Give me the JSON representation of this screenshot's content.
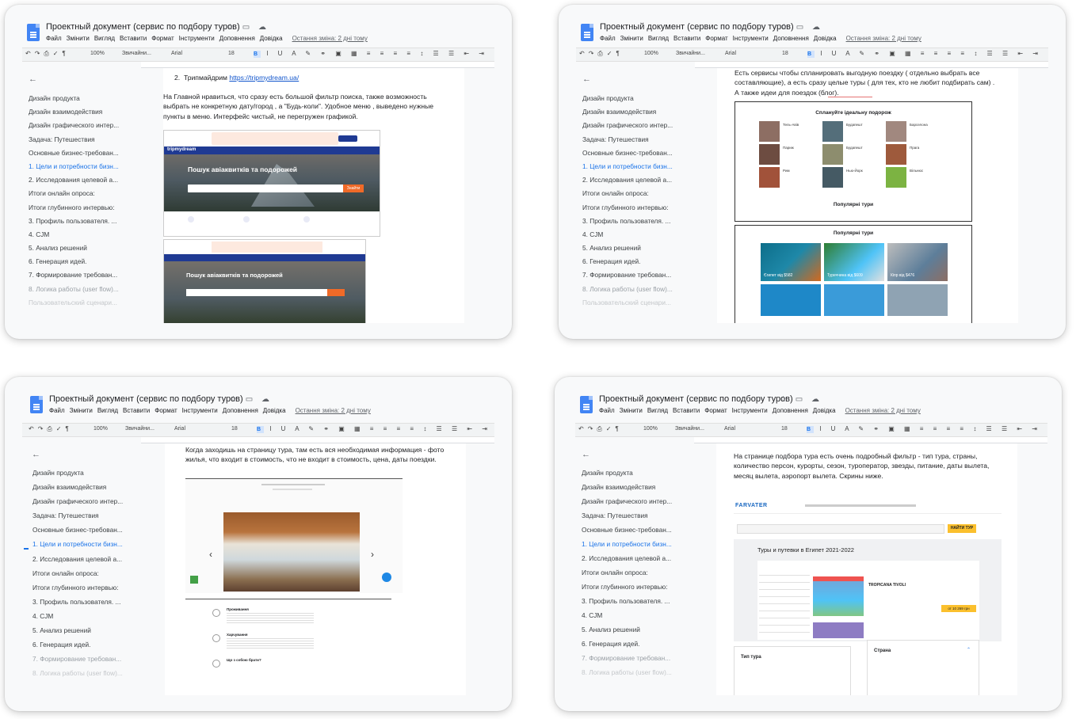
{
  "doc": {
    "title": "Проектный документ (сервис по подбору туров)",
    "menu": [
      "Файл",
      "Змінити",
      "Вигляд",
      "Вставити",
      "Формат",
      "Інструменти",
      "Доповнення",
      "Довідка"
    ],
    "last_edit": "Остання зміна: 2 дні тому",
    "toolbar": {
      "zoom": "100%",
      "style": "Звичайни...",
      "font": "Arial",
      "size": "18"
    },
    "outline": [
      "Дизайн продукта",
      "Дизайн взаимодействия",
      "Дизайн графического интер...",
      "Задача: Путешествия",
      "Основные бизнес-требован...",
      "1. Цели и потребности бизн...",
      "2. Исследования целевой а...",
      "Итоги онлайн опроса:",
      "Итоги глубинного интервью:",
      "3. Профиль пользователя. ...",
      "4. CJM",
      "5. Анализ решений",
      "6. Генерация идей.",
      "7. Формирование требован...",
      "8. Логика работы (user flow)...",
      "Пользовательский сценари..."
    ],
    "outline_bl": [
      "Дизайн продукта",
      "Дизайн взаимодействия",
      "Дизайн графического интер...",
      "Задача: Путешествия",
      "Основные бизнес-требован...",
      "1. Цели и потребности бизн...",
      "2. Исследования целевой а...",
      "Итоги онлайн опроса:",
      "Итоги глубинного интервью:",
      "3. Профиль пользователя. ...",
      "4. CJM",
      "5. Анализ решений",
      "6. Генерация идей.",
      "7. Формирование требован...",
      "8. Логика работы (user flow)..."
    ]
  },
  "panel1": {
    "heading_num": "2.",
    "heading": "Трипмайдрим",
    "link": "https://tripmydream.ua/",
    "text": "На Главной нравиться, что сразу есть большой фильтр поиска, также возможность выбрать не конкретную дату/город , а \"Будь-коли\". Удобное меню , выведено нужные пункты в меню. Интерфейс чистый, не перегружен графикой.",
    "site_logo": "tripmydream",
    "hero": "Пошук авіаквитків та подорожей",
    "btn": "Знайти"
  },
  "panel2": {
    "text": "Есть сервисы чтобы спланировать выгодную поездку ( отдельно выбрать все составляющие), а есть сразу целые туры ( для тех, кто не любит подбирать сам) . А также идеи для поездок (блог).",
    "section1": "Сплануйте ідеальну подорож",
    "section2": "Популярні тури",
    "section3": "Популярні тури",
    "cities": [
      "Тель-Авів",
      "Будапешт",
      "Барселона",
      "Париж",
      "Будапешт",
      "Прага",
      "Рим",
      "Нью-Йорк",
      "Вільнюс"
    ],
    "tours": [
      "Єгипет від $582",
      "Туреччина від $609",
      "Кіпр від $476"
    ]
  },
  "panel3": {
    "text": "Когда заходишь на страницу тура, там есть вся необходимая информация - фото жилья, что входит в стоимость, что не входит в стоимость, цена, даты поездки.",
    "steps": [
      "Проживання",
      "Харчування",
      "Що з собою брати?"
    ]
  },
  "panel4": {
    "text": "На странице подбора тура есть очень подробный фильтр - тип тура, страны, количество персон, курорты, сезон, туроператор, звезды, питание, даты вылета, месяц вылета, аэропорт вылета. Скрины ниже.",
    "brand": "FARVATER",
    "btn": "НАЙТИ ТУР",
    "heading": "Туры и путевки в Египет 2021-2022",
    "hotel": "TROPICANA TIVOLI",
    "price": "от 10 269 грн",
    "filter1": "Тип тура",
    "filter2": "Страна"
  },
  "colors": {
    "accent": "#1a73e8",
    "doc_blue": "#4285f4",
    "orange": "#f06a28"
  }
}
